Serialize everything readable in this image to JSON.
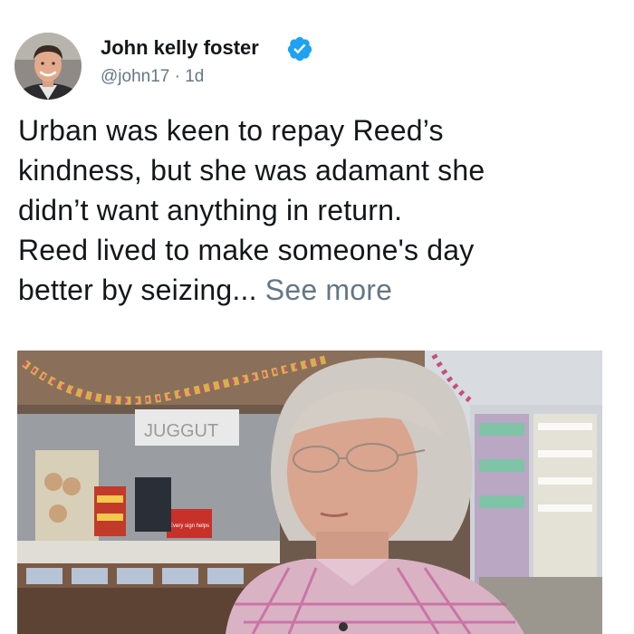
{
  "author": {
    "name": "John kelly foster",
    "handle": "@john17",
    "separator": " · ",
    "time": "1d",
    "verified_color": "#1da1f2"
  },
  "tweet": {
    "lines": [
      "Urban was keen to repay Reed’s",
      "kindness, but she was adamant she",
      "didn’t want anything in return.",
      "Reed lived to make someone's day",
      "better by seizing..."
    ],
    "see_more": "See more"
  },
  "media": {
    "sign_text": "JUGGUT",
    "sticker_text": "Every sign helps"
  },
  "colors": {
    "name": "#14171a",
    "secondary": "#657786",
    "verified": "#1da1f2"
  }
}
